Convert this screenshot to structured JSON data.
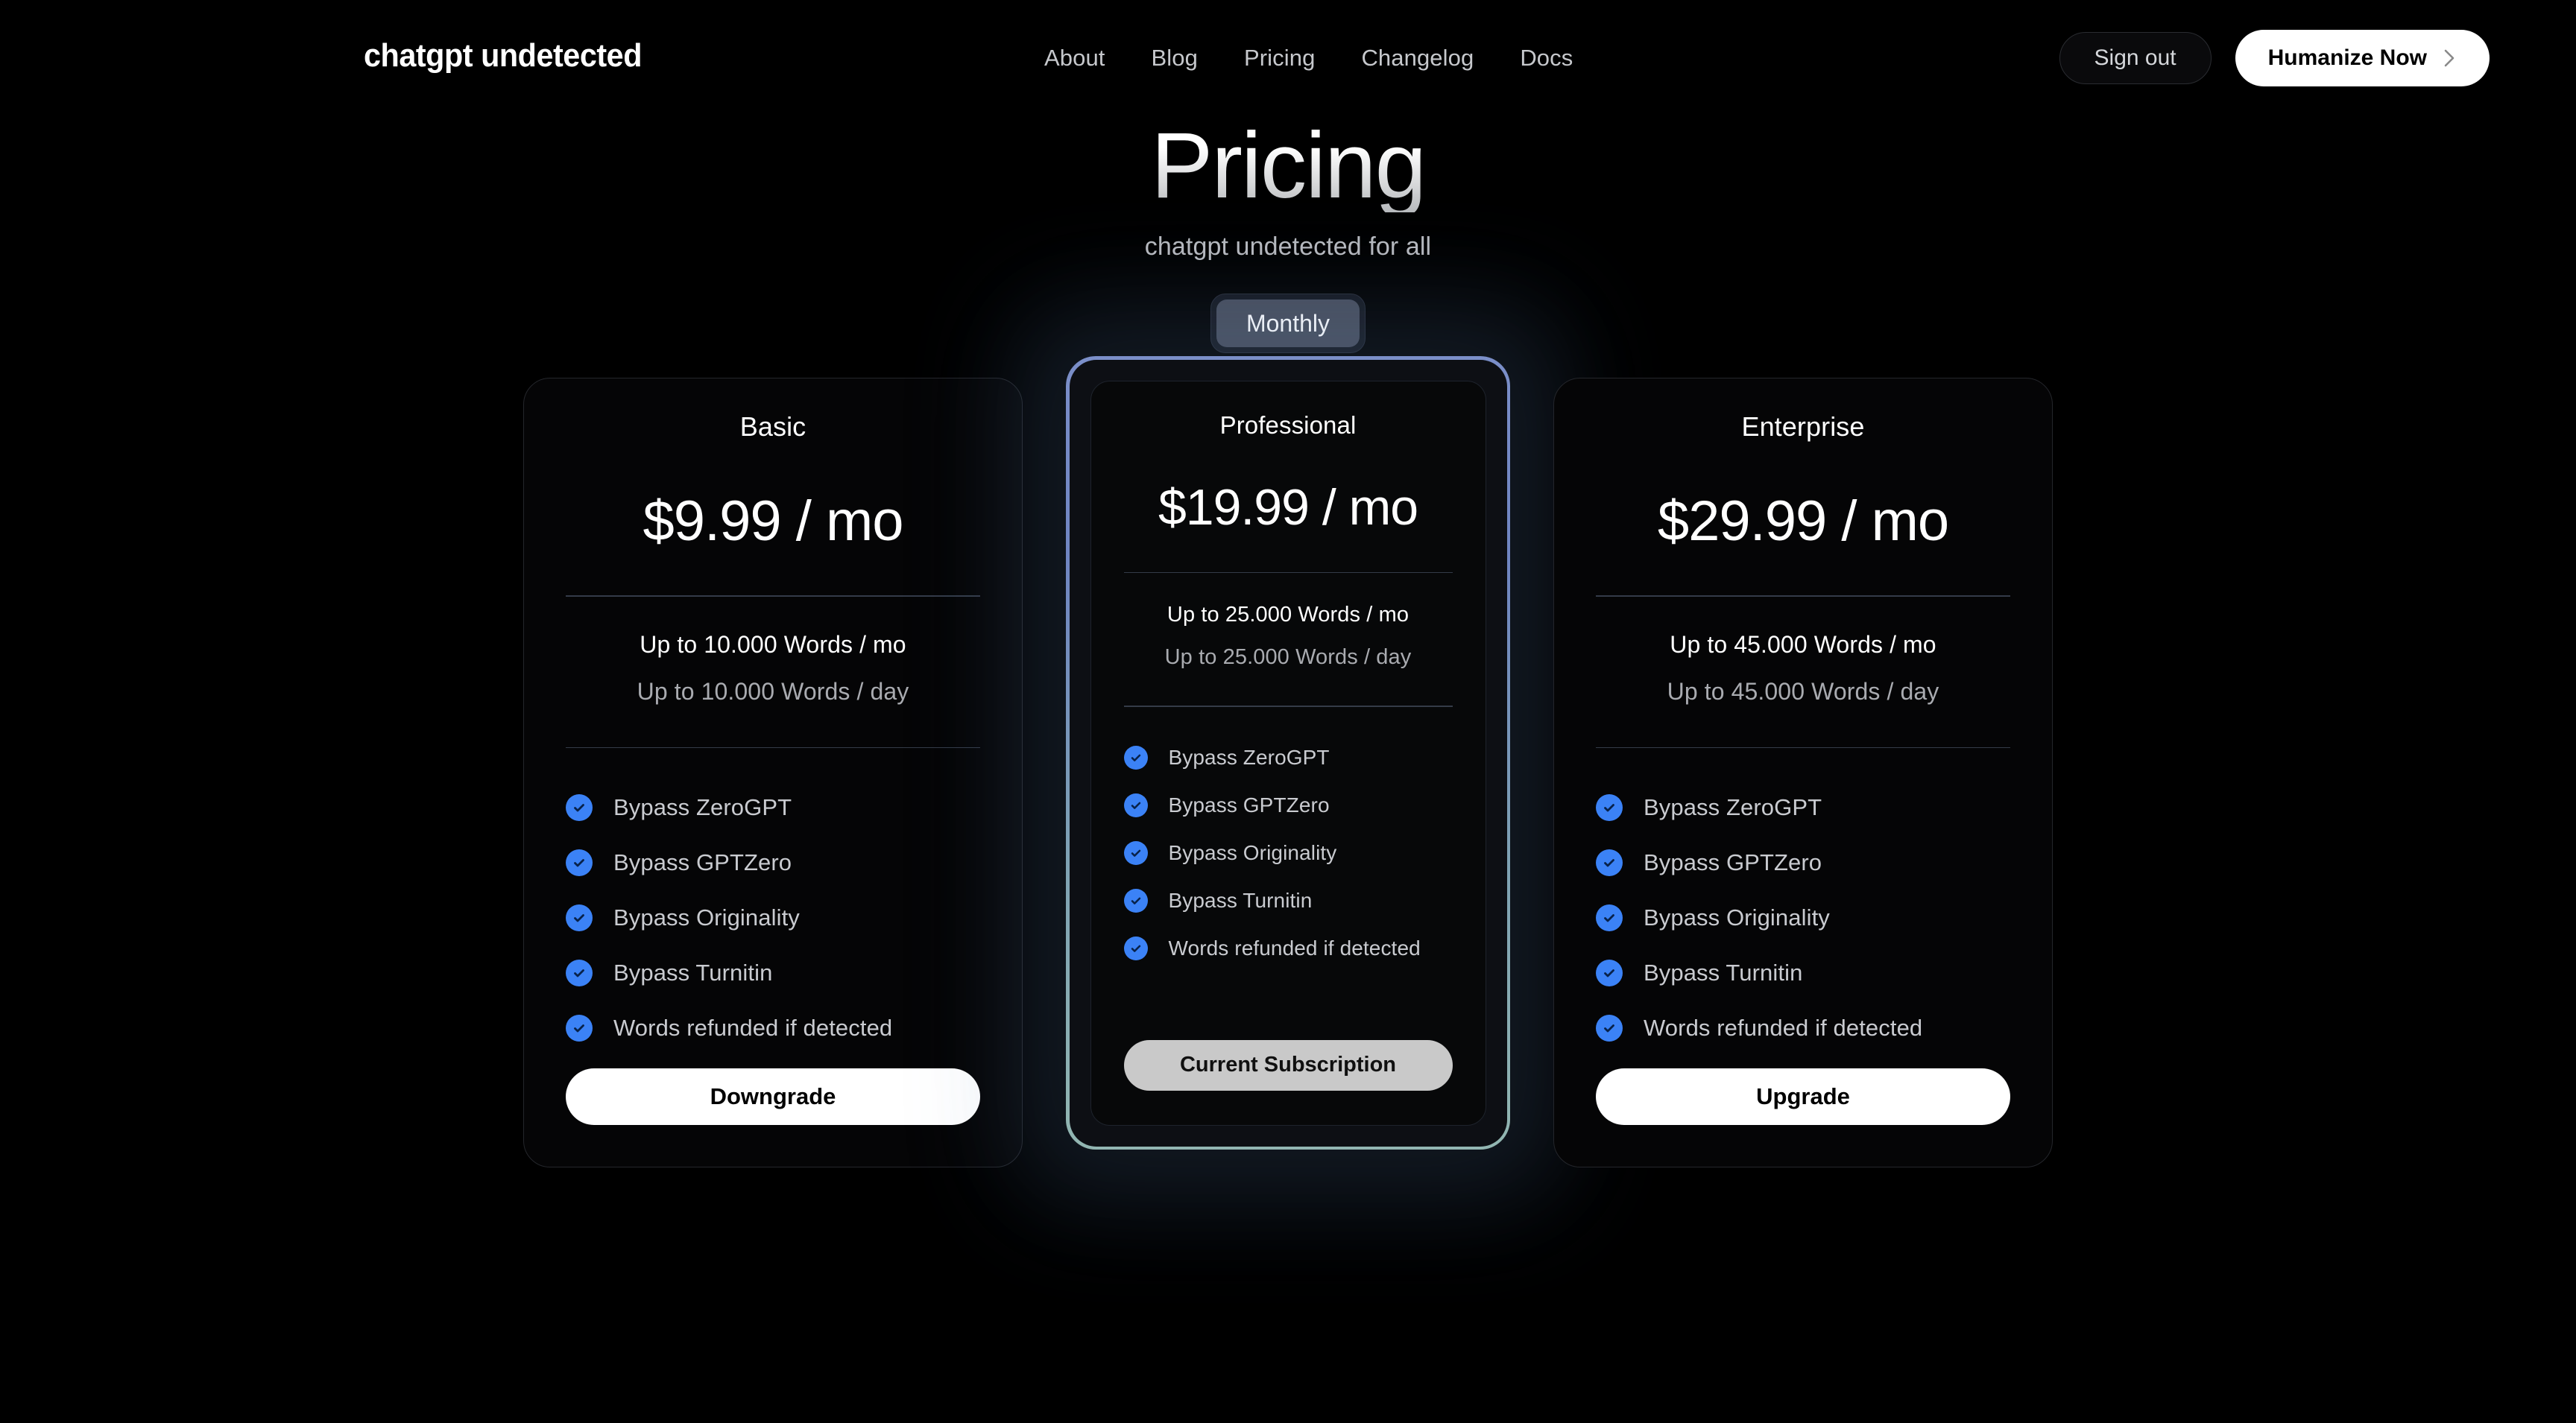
{
  "header": {
    "logo": "chatgpt undetected",
    "nav": [
      {
        "label": "About"
      },
      {
        "label": "Blog"
      },
      {
        "label": "Pricing"
      },
      {
        "label": "Changelog"
      },
      {
        "label": "Docs"
      }
    ],
    "sign_out_label": "Sign out",
    "humanize_label": "Humanize Now",
    "humanize_icon": "chevron-right-icon"
  },
  "hero": {
    "title": "Pricing",
    "subtitle": "chatgpt undetected for all"
  },
  "billing_toggle": {
    "selected": "Monthly",
    "options": [
      "Monthly"
    ]
  },
  "colors": {
    "page_background": "#000000",
    "card_background": "#050506",
    "card_border": "#24262b",
    "featured_border_top": "#7b8fc9",
    "featured_border_bottom": "#92b6b2",
    "check_blue": "#3b82f6",
    "divider": "#343b48",
    "cta_white": "#ffffff",
    "cta_current": "#c9c9c9",
    "toggle_pill": "#474d5b",
    "text_primary": "#ffffff",
    "text_muted": "#a9abb0"
  },
  "plans": [
    {
      "name": "Basic",
      "price": "$9.99 / mo",
      "words_month": "Up to 10.000 Words / mo",
      "words_day": "Up to 10.000 Words / day",
      "features": [
        "Bypass ZeroGPT",
        "Bypass GPTZero",
        "Bypass Originality",
        "Bypass Turnitin",
        "Words refunded if detected"
      ],
      "cta_label": "Downgrade",
      "featured": false
    },
    {
      "name": "Professional",
      "price": "$19.99 / mo",
      "words_month": "Up to 25.000 Words / mo",
      "words_day": "Up to 25.000 Words / day",
      "features": [
        "Bypass ZeroGPT",
        "Bypass GPTZero",
        "Bypass Originality",
        "Bypass Turnitin",
        "Words refunded if detected"
      ],
      "cta_label": "Current Subscription",
      "featured": true
    },
    {
      "name": "Enterprise",
      "price": "$29.99 / mo",
      "words_month": "Up to 45.000 Words / mo",
      "words_day": "Up to 45.000 Words / day",
      "features": [
        "Bypass ZeroGPT",
        "Bypass GPTZero",
        "Bypass Originality",
        "Bypass Turnitin",
        "Words refunded if detected"
      ],
      "cta_label": "Upgrade",
      "featured": false
    }
  ]
}
